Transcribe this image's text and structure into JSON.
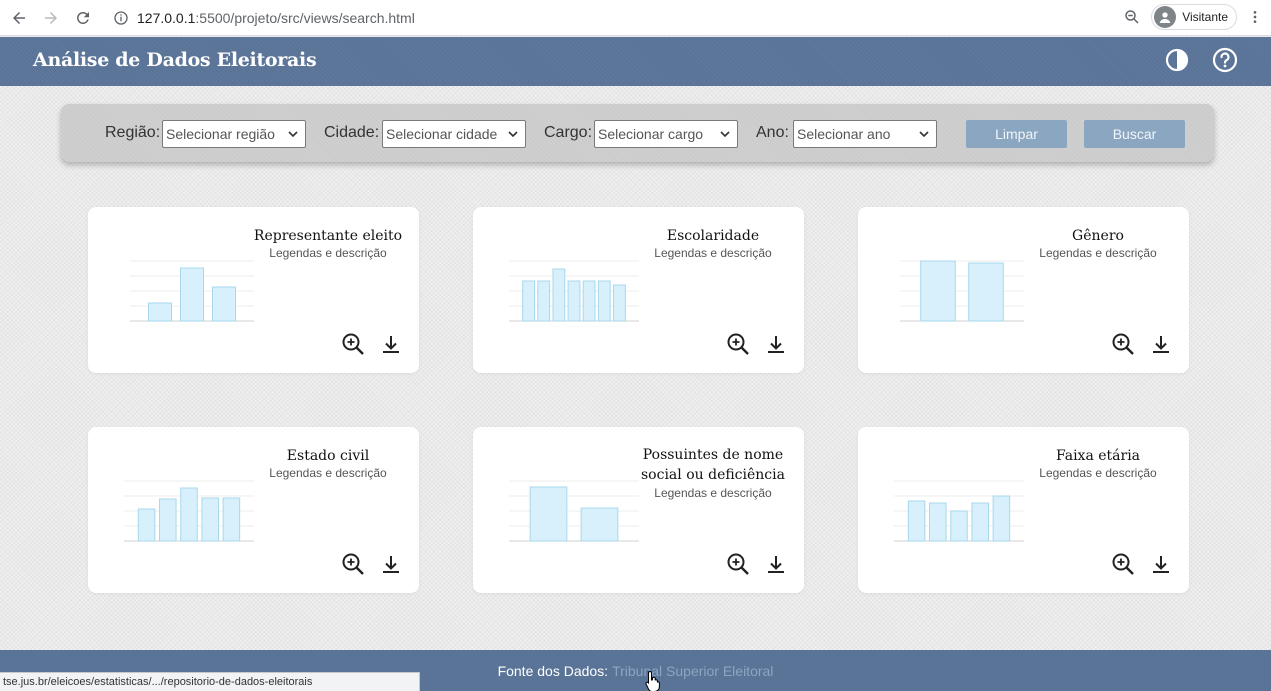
{
  "browser": {
    "url_host": "127.0.0.1",
    "url_path": ":5500/projeto/src/views/search.html",
    "profile_label": "Visitante"
  },
  "header": {
    "title": "Análise de Dados Eleitorais"
  },
  "filters": {
    "regiao_label": "Região:",
    "regiao_value": "Selecionar região",
    "cidade_label": "Cidade:",
    "cidade_value": "Selecionar cidade",
    "cargo_label": "Cargo:",
    "cargo_value": "Selecionar cargo",
    "ano_label": "Ano:",
    "ano_value": "Selecionar ano",
    "clear_label": "Limpar",
    "search_label": "Buscar"
  },
  "cards": [
    {
      "title": "Representante eleito",
      "subtitle": "Legendas e descrição"
    },
    {
      "title": "Escolaridade",
      "subtitle": "Legendas e descrição"
    },
    {
      "title": "Gênero",
      "subtitle": "Legendas e descrição"
    },
    {
      "title": "Estado civil",
      "subtitle": "Legendas e descrição"
    },
    {
      "title_line1": "Possuintes de nome",
      "title_line2": "social ou deficiência",
      "subtitle": "Legendas e descrição"
    },
    {
      "title": "Faixa etária",
      "subtitle": "Legendas e descrição"
    }
  ],
  "footer": {
    "source_label": "Fonte dos Dados:",
    "source_link": "Tribunal Superior Eleitoral"
  },
  "status_url": "tse.jus.br/eleicoes/estatisticas/.../repositorio-de-dados-eleitorais",
  "colors": {
    "header_bg": "#5a7498",
    "button_bg": "#8ba6c1",
    "chart_fill": "#d8f0fb",
    "chart_stroke": "#a8d8ee"
  },
  "chart_data": [
    {
      "type": "bar",
      "values": [
        18,
        53,
        34
      ],
      "ylim": [
        0,
        60
      ]
    },
    {
      "type": "bar",
      "values": [
        40,
        40,
        52,
        40,
        40,
        40,
        36
      ],
      "ylim": [
        0,
        60
      ]
    },
    {
      "type": "bar",
      "values": [
        60,
        58
      ],
      "ylim": [
        0,
        60
      ]
    },
    {
      "type": "bar",
      "values": [
        32,
        42,
        53,
        43,
        43
      ],
      "ylim": [
        0,
        60
      ]
    },
    {
      "type": "bar",
      "values": [
        54,
        33
      ],
      "ylim": [
        0,
        60
      ]
    },
    {
      "type": "bar",
      "values": [
        40,
        38,
        30,
        38,
        45
      ],
      "ylim": [
        0,
        60
      ]
    }
  ]
}
